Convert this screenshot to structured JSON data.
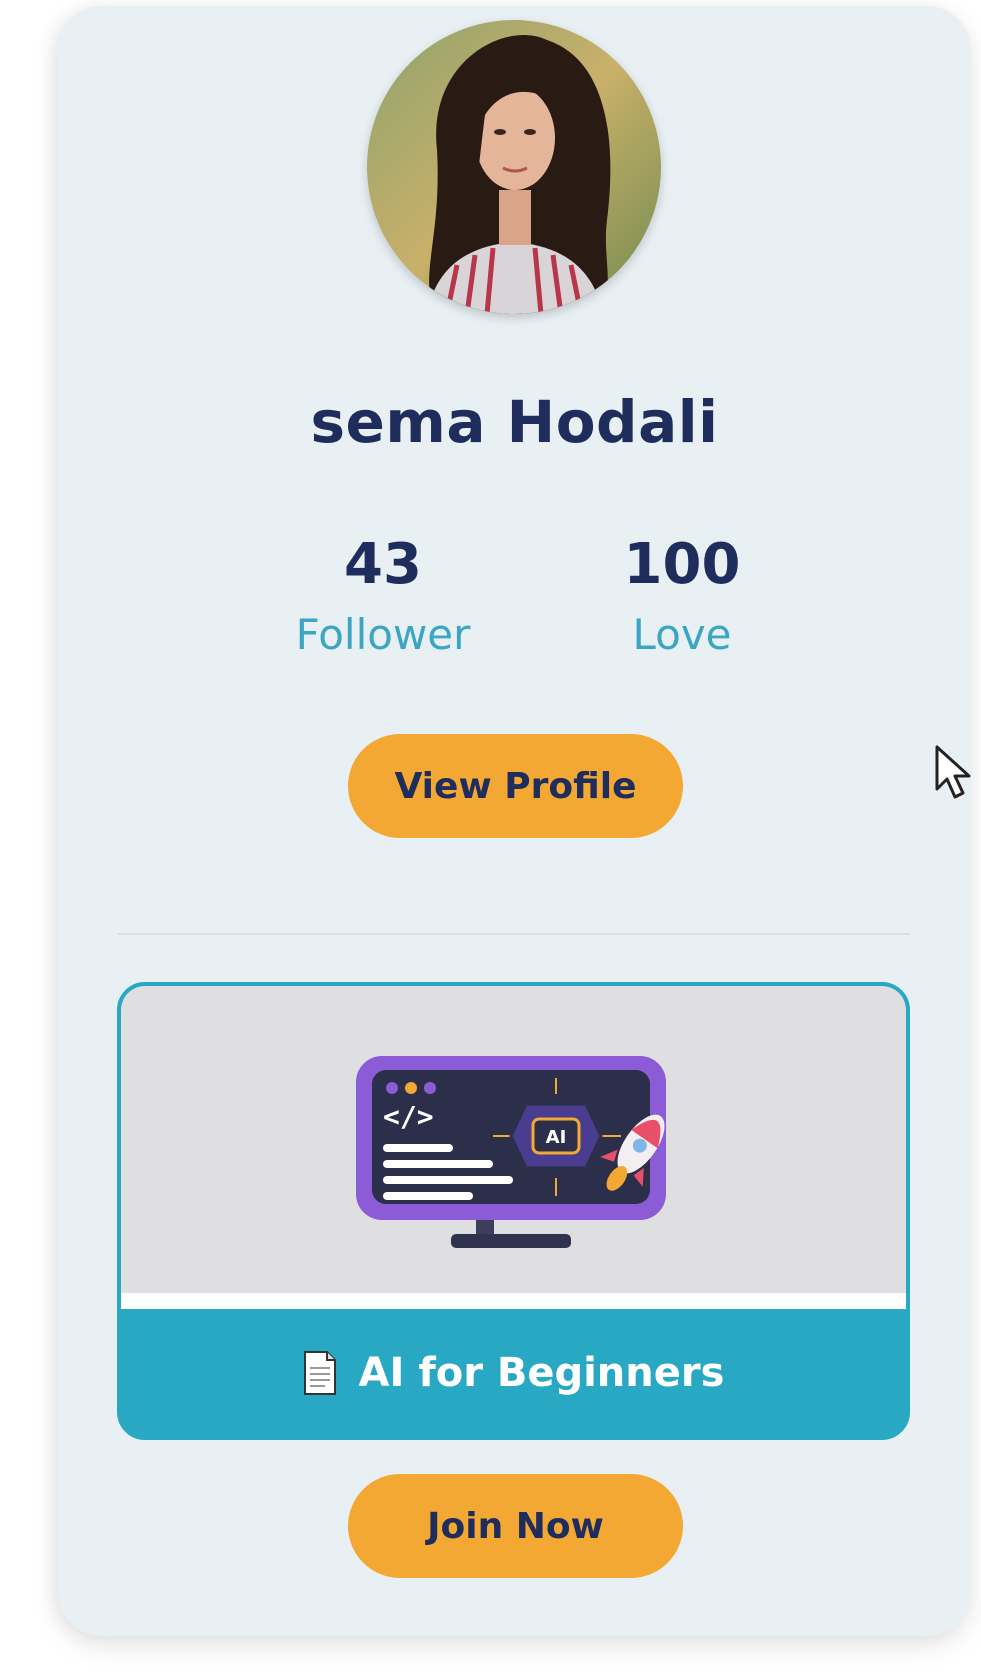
{
  "profile": {
    "name": "sema Hodali",
    "stats": [
      {
        "value": "43",
        "label": "Follower"
      },
      {
        "value": "100",
        "label": "Love"
      }
    ],
    "view_profile_label": "View Profile"
  },
  "course": {
    "title": "AI for Beginners",
    "icon": "document-icon",
    "image_badge": "AI",
    "join_label": "Join Now"
  },
  "colors": {
    "accent": "#f3a833",
    "teal": "#29a8c3",
    "navy": "#1f2d5c",
    "card_bg": "#e8f0f4"
  }
}
